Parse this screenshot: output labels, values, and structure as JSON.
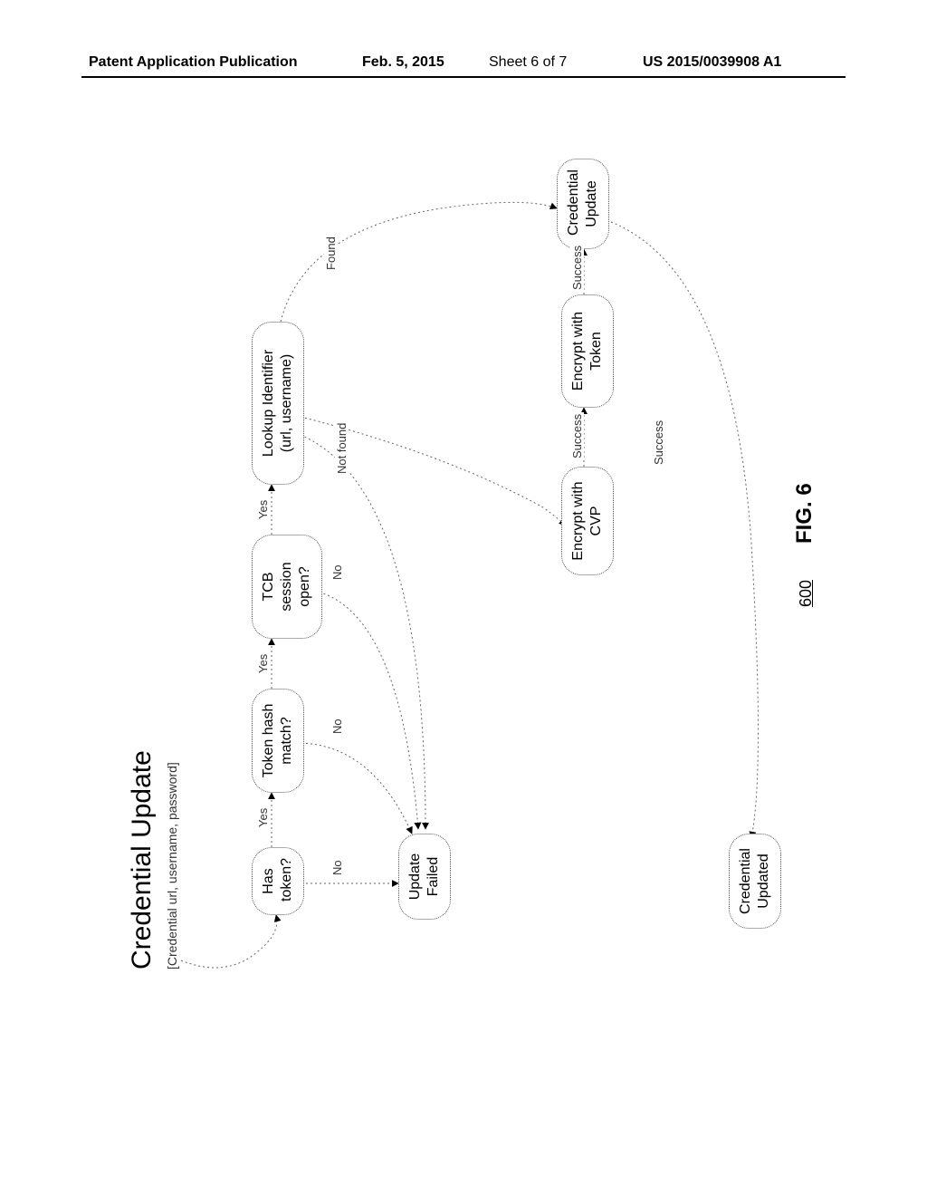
{
  "header": {
    "publication_type": "Patent Application Publication",
    "date": "Feb. 5, 2015",
    "sheet": "Sheet 6 of 7",
    "pub_number": "US 2015/0039908 A1"
  },
  "diagram": {
    "title": "Credential Update",
    "subtitle": "[Credential url, username, password]",
    "reference_number": "600",
    "figure_label": "FIG. 6",
    "nodes": {
      "has_token": "Has\ntoken?",
      "token_hash": "Token hash\nmatch?",
      "tcb_session": "TCB session\nopen?",
      "lookup_identifier": "Lookup Identifier\n(url, username)",
      "update_failed": "Update\nFailed",
      "encrypt_cvp": "Encrypt with\nCVP",
      "encrypt_token": "Encrypt with\nToken",
      "credential_update": "Credential\nUpdate",
      "credential_updated": "Credential\nUpdated"
    },
    "edges": {
      "yes1": "Yes",
      "yes2": "Yes",
      "yes3": "Yes",
      "no1": "No",
      "no2": "No",
      "no3": "No",
      "not_found": "Not found",
      "found": "Found",
      "success1": "Success",
      "success2": "Success",
      "success3": "Success"
    }
  }
}
